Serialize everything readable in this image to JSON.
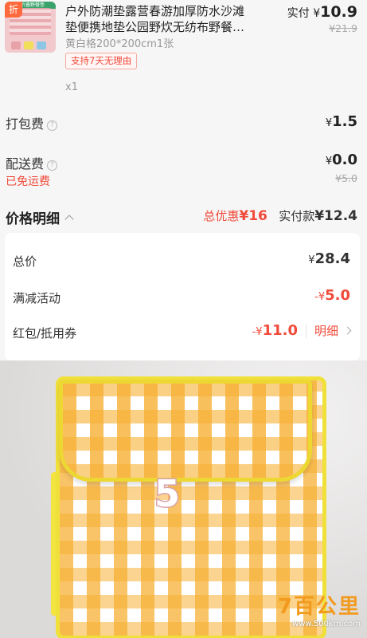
{
  "product": {
    "discount_badge": "折",
    "thumb_strip": "可折叠野餐垫",
    "title_line1": "户外防潮垫露营春游加厚防水沙滩",
    "title_line2": "垫便携地垫公园野炊无纺布野餐…",
    "spec": "黄白格200*200cm1张",
    "return_tag": "支持7天无理由",
    "quantity": "x1",
    "paid_label": "实付",
    "paid_currency": "¥",
    "paid_value": "10.9",
    "original_price": "¥21.9"
  },
  "fees": {
    "packing_label": "打包费",
    "packing_currency": "¥",
    "packing_value": "1.5",
    "delivery_label": "配送费",
    "delivery_currency": "¥",
    "delivery_value": "0.0",
    "delivery_original": "¥5.0",
    "free_delivery": "已免运费"
  },
  "price_detail": {
    "title": "价格明细",
    "total_discount_label": "总优惠",
    "total_discount_value": "¥16",
    "paid_label": "实付款",
    "paid_value": "¥12.4",
    "rows": [
      {
        "label": "总价",
        "currency": "¥",
        "value": "28.4"
      },
      {
        "label": "满减活动",
        "currency": "-¥",
        "value": "5.0"
      },
      {
        "label": "红包/抵用券",
        "currency": "-¥",
        "value": "11.0",
        "link": "明细"
      }
    ]
  },
  "photo": {
    "overlay_number": "5",
    "watermark_logo": "7百公里",
    "watermark_url": "www.500km.com"
  },
  "colors": {
    "accent_red": "#f04a3a",
    "page_bg": "#f6f6f6",
    "gingham_orange": "#f7b034",
    "trim_yellow": "#f0e03a"
  }
}
